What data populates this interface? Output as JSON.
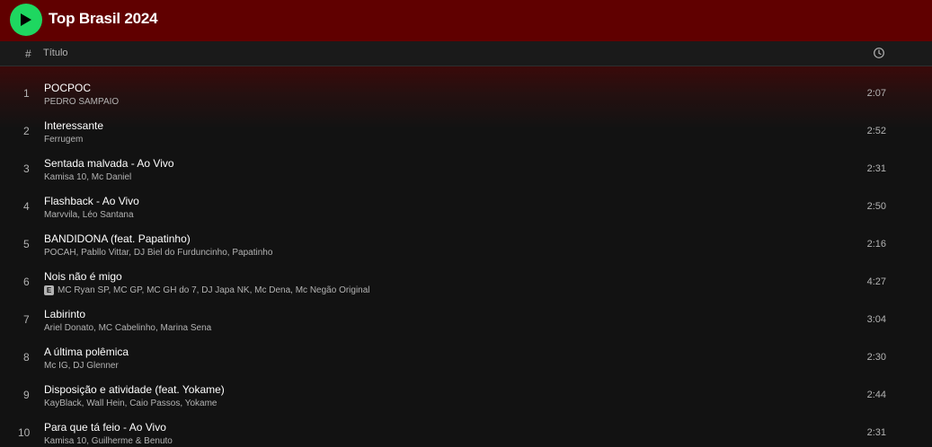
{
  "playlist": {
    "title": "Top Brasil 2024"
  },
  "columns": {
    "number": "#",
    "title": "Título"
  },
  "colors": {
    "header_bg": "#600000",
    "play_button": "#1ed760",
    "background": "#121212"
  },
  "icons": {
    "play": "play-icon",
    "clock": "clock-icon",
    "explicit": "explicit-icon"
  },
  "tracks": [
    {
      "num": "1",
      "title": "POCPOC",
      "artists": "PEDRO SAMPAIO",
      "explicit": false,
      "duration": "2:07"
    },
    {
      "num": "2",
      "title": "Interessante",
      "artists": "Ferrugem",
      "explicit": false,
      "duration": "2:52"
    },
    {
      "num": "3",
      "title": "Sentada malvada - Ao Vivo",
      "artists": "Kamisa 10, Mc Daniel",
      "explicit": false,
      "duration": "2:31"
    },
    {
      "num": "4",
      "title": "Flashback - Ao Vivo",
      "artists": "Marvvila, Léo Santana",
      "explicit": false,
      "duration": "2:50"
    },
    {
      "num": "5",
      "title": "BANDIDONA (feat. Papatinho)",
      "artists": "POCAH, Pabllo Vittar, DJ Biel do Furduncinho, Papatinho",
      "explicit": false,
      "duration": "2:16"
    },
    {
      "num": "6",
      "title": "Nois não é migo",
      "artists": "MC Ryan SP, MC GP, MC GH do 7, DJ Japa NK, Mc Dena, Mc Negão Original",
      "explicit": true,
      "explicit_label": "E",
      "duration": "4:27"
    },
    {
      "num": "7",
      "title": "Labirinto",
      "artists": "Ariel Donato, MC Cabelinho, Marina Sena",
      "explicit": false,
      "duration": "3:04"
    },
    {
      "num": "8",
      "title": "A última polêmica",
      "artists": "Mc IG, DJ Glenner",
      "explicit": false,
      "duration": "2:30"
    },
    {
      "num": "9",
      "title": "Disposição e atividade (feat. Yokame)",
      "artists": "KayBlack, Wall Hein, Caio Passos, Yokame",
      "explicit": false,
      "duration": "2:44"
    },
    {
      "num": "10",
      "title": "Para que tá feio - Ao Vivo",
      "artists": "Kamisa 10, Guilherme & Benuto",
      "explicit": false,
      "duration": "2:31"
    }
  ]
}
